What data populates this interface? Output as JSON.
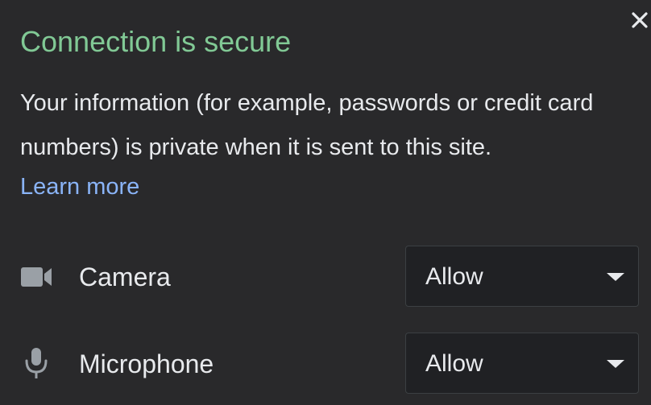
{
  "popup": {
    "title": "Connection is secure",
    "description": "Your information (for example, passwords or credit card numbers) is private when it is sent to this site.",
    "learn_more": "Learn more",
    "close_icon": "close-icon",
    "permissions": [
      {
        "icon": "camera-icon",
        "label": "Camera",
        "value": "Allow"
      },
      {
        "icon": "microphone-icon",
        "label": "Microphone",
        "value": "Allow"
      }
    ]
  },
  "colors": {
    "background": "#29292b",
    "title": "#81c995",
    "text": "#e8eaed",
    "link": "#8ab4f8",
    "select_background": "#202124",
    "icon": "#9aa0a6"
  }
}
